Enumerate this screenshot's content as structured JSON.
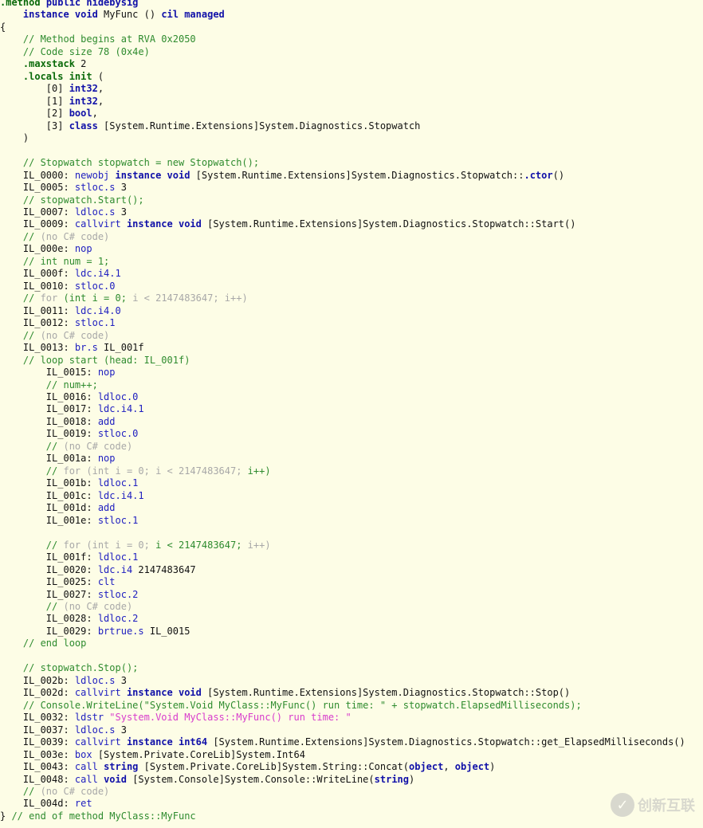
{
  "colors": {
    "keyword": "#1010a8",
    "opcode": "#2020c0",
    "comment": "#2e8b2e",
    "inactive": "#a8a8a8",
    "string": "#d83ccc",
    "background": "#fdfde6"
  },
  "watermark": {
    "text": "创新互联",
    "icon": "brand-logo-icon"
  },
  "lines": [
    [
      {
        "c": "d",
        "t": ".method"
      },
      {
        "c": "t",
        "t": " "
      },
      {
        "c": "k",
        "t": "public hidebysig"
      }
    ],
    [
      {
        "c": "t",
        "t": "    "
      },
      {
        "c": "k",
        "t": "instance void"
      },
      {
        "c": "t",
        "t": " MyFunc () "
      },
      {
        "c": "k",
        "t": "cil managed"
      }
    ],
    [
      {
        "c": "t",
        "t": "{"
      }
    ],
    [
      {
        "c": "c",
        "t": "    // Method begins at RVA 0x2050"
      }
    ],
    [
      {
        "c": "c",
        "t": "    // Code size 78 (0x4e)"
      }
    ],
    [
      {
        "c": "t",
        "t": "    "
      },
      {
        "c": "d",
        "t": ".maxstack"
      },
      {
        "c": "t",
        "t": " 2"
      }
    ],
    [
      {
        "c": "t",
        "t": "    "
      },
      {
        "c": "d",
        "t": ".locals init"
      },
      {
        "c": "t",
        "t": " ("
      }
    ],
    [
      {
        "c": "t",
        "t": "        [0] "
      },
      {
        "c": "k",
        "t": "int32"
      },
      {
        "c": "t",
        "t": ","
      }
    ],
    [
      {
        "c": "t",
        "t": "        [1] "
      },
      {
        "c": "k",
        "t": "int32"
      },
      {
        "c": "t",
        "t": ","
      }
    ],
    [
      {
        "c": "t",
        "t": "        [2] "
      },
      {
        "c": "k",
        "t": "bool"
      },
      {
        "c": "t",
        "t": ","
      }
    ],
    [
      {
        "c": "t",
        "t": "        [3] "
      },
      {
        "c": "k",
        "t": "class"
      },
      {
        "c": "t",
        "t": " [System.Runtime.Extensions]System.Diagnostics.Stopwatch"
      }
    ],
    [
      {
        "c": "t",
        "t": "    )"
      }
    ],
    [],
    [
      {
        "c": "c",
        "t": "    // Stopwatch stopwatch = new Stopwatch();"
      }
    ],
    [
      {
        "c": "t",
        "t": "    IL_0000: "
      },
      {
        "c": "o",
        "t": "newobj"
      },
      {
        "c": "t",
        "t": " "
      },
      {
        "c": "k",
        "t": "instance void"
      },
      {
        "c": "t",
        "t": " [System.Runtime.Extensions]System.Diagnostics.Stopwatch::"
      },
      {
        "c": "k",
        "t": ".ctor"
      },
      {
        "c": "t",
        "t": "()"
      }
    ],
    [
      {
        "c": "t",
        "t": "    IL_0005: "
      },
      {
        "c": "o",
        "t": "stloc.s"
      },
      {
        "c": "t",
        "t": " 3"
      }
    ],
    [
      {
        "c": "c",
        "t": "    // stopwatch.Start();"
      }
    ],
    [
      {
        "c": "t",
        "t": "    IL_0007: "
      },
      {
        "c": "o",
        "t": "ldloc.s"
      },
      {
        "c": "t",
        "t": " 3"
      }
    ],
    [
      {
        "c": "t",
        "t": "    IL_0009: "
      },
      {
        "c": "o",
        "t": "callvirt"
      },
      {
        "c": "t",
        "t": " "
      },
      {
        "c": "k",
        "t": "instance void"
      },
      {
        "c": "t",
        "t": " [System.Runtime.Extensions]System.Diagnostics.Stopwatch::Start()"
      }
    ],
    [
      {
        "c": "c",
        "t": "    //"
      },
      {
        "c": "g",
        "t": " (no C# code)"
      }
    ],
    [
      {
        "c": "t",
        "t": "    IL_000e: "
      },
      {
        "c": "o",
        "t": "nop"
      }
    ],
    [
      {
        "c": "c",
        "t": "    // int num = 1;"
      }
    ],
    [
      {
        "c": "t",
        "t": "    IL_000f: "
      },
      {
        "c": "o",
        "t": "ldc.i4.1"
      }
    ],
    [
      {
        "c": "t",
        "t": "    IL_0010: "
      },
      {
        "c": "o",
        "t": "stloc.0"
      }
    ],
    [
      {
        "c": "c",
        "t": "    //"
      },
      {
        "c": "g",
        "t": " for "
      },
      {
        "c": "c",
        "t": "(int i = 0;"
      },
      {
        "c": "g",
        "t": " i < 2147483647; i++)"
      }
    ],
    [
      {
        "c": "t",
        "t": "    IL_0011: "
      },
      {
        "c": "o",
        "t": "ldc.i4.0"
      }
    ],
    [
      {
        "c": "t",
        "t": "    IL_0012: "
      },
      {
        "c": "o",
        "t": "stloc.1"
      }
    ],
    [
      {
        "c": "c",
        "t": "    //"
      },
      {
        "c": "g",
        "t": " (no C# code)"
      }
    ],
    [
      {
        "c": "t",
        "t": "    IL_0013: "
      },
      {
        "c": "o",
        "t": "br.s"
      },
      {
        "c": "t",
        "t": " IL_001f"
      }
    ],
    [
      {
        "c": "c",
        "t": "    // loop start (head: IL_001f)"
      }
    ],
    [
      {
        "c": "t",
        "t": "        IL_0015: "
      },
      {
        "c": "o",
        "t": "nop"
      }
    ],
    [
      {
        "c": "c",
        "t": "        // num++;"
      }
    ],
    [
      {
        "c": "t",
        "t": "        IL_0016: "
      },
      {
        "c": "o",
        "t": "ldloc.0"
      }
    ],
    [
      {
        "c": "t",
        "t": "        IL_0017: "
      },
      {
        "c": "o",
        "t": "ldc.i4.1"
      }
    ],
    [
      {
        "c": "t",
        "t": "        IL_0018: "
      },
      {
        "c": "o",
        "t": "add"
      }
    ],
    [
      {
        "c": "t",
        "t": "        IL_0019: "
      },
      {
        "c": "o",
        "t": "stloc.0"
      }
    ],
    [
      {
        "c": "c",
        "t": "        //"
      },
      {
        "c": "g",
        "t": " (no C# code)"
      }
    ],
    [
      {
        "c": "t",
        "t": "        IL_001a: "
      },
      {
        "c": "o",
        "t": "nop"
      }
    ],
    [
      {
        "c": "c",
        "t": "        //"
      },
      {
        "c": "g",
        "t": " for (int i = 0; i < 2147483647; "
      },
      {
        "c": "c",
        "t": "i++)"
      }
    ],
    [
      {
        "c": "t",
        "t": "        IL_001b: "
      },
      {
        "c": "o",
        "t": "ldloc.1"
      }
    ],
    [
      {
        "c": "t",
        "t": "        IL_001c: "
      },
      {
        "c": "o",
        "t": "ldc.i4.1"
      }
    ],
    [
      {
        "c": "t",
        "t": "        IL_001d: "
      },
      {
        "c": "o",
        "t": "add"
      }
    ],
    [
      {
        "c": "t",
        "t": "        IL_001e: "
      },
      {
        "c": "o",
        "t": "stloc.1"
      }
    ],
    [],
    [
      {
        "c": "c",
        "t": "        //"
      },
      {
        "c": "g",
        "t": " for (int i = 0; "
      },
      {
        "c": "c",
        "t": "i < 2147483647;"
      },
      {
        "c": "g",
        "t": " i++)"
      }
    ],
    [
      {
        "c": "t",
        "t": "        IL_001f: "
      },
      {
        "c": "o",
        "t": "ldloc.1"
      }
    ],
    [
      {
        "c": "t",
        "t": "        IL_0020: "
      },
      {
        "c": "o",
        "t": "ldc.i4"
      },
      {
        "c": "t",
        "t": " 2147483647"
      }
    ],
    [
      {
        "c": "t",
        "t": "        IL_0025: "
      },
      {
        "c": "o",
        "t": "clt"
      }
    ],
    [
      {
        "c": "t",
        "t": "        IL_0027: "
      },
      {
        "c": "o",
        "t": "stloc.2"
      }
    ],
    [
      {
        "c": "c",
        "t": "        //"
      },
      {
        "c": "g",
        "t": " (no C# code)"
      }
    ],
    [
      {
        "c": "t",
        "t": "        IL_0028: "
      },
      {
        "c": "o",
        "t": "ldloc.2"
      }
    ],
    [
      {
        "c": "t",
        "t": "        IL_0029: "
      },
      {
        "c": "o",
        "t": "brtrue.s"
      },
      {
        "c": "t",
        "t": " IL_0015"
      }
    ],
    [
      {
        "c": "c",
        "t": "    // end loop"
      }
    ],
    [],
    [
      {
        "c": "c",
        "t": "    // stopwatch.Stop();"
      }
    ],
    [
      {
        "c": "t",
        "t": "    IL_002b: "
      },
      {
        "c": "o",
        "t": "ldloc.s"
      },
      {
        "c": "t",
        "t": " 3"
      }
    ],
    [
      {
        "c": "t",
        "t": "    IL_002d: "
      },
      {
        "c": "o",
        "t": "callvirt"
      },
      {
        "c": "t",
        "t": " "
      },
      {
        "c": "k",
        "t": "instance void"
      },
      {
        "c": "t",
        "t": " [System.Runtime.Extensions]System.Diagnostics.Stopwatch::Stop()"
      }
    ],
    [
      {
        "c": "c",
        "t": "    // Console.WriteLine(\"System.Void MyClass::MyFunc() run time: \" + stopwatch.ElapsedMilliseconds);"
      }
    ],
    [
      {
        "c": "t",
        "t": "    IL_0032: "
      },
      {
        "c": "o",
        "t": "ldstr"
      },
      {
        "c": "t",
        "t": " "
      },
      {
        "c": "s",
        "t": "\"System.Void MyClass::MyFunc() run time: \""
      }
    ],
    [
      {
        "c": "t",
        "t": "    IL_0037: "
      },
      {
        "c": "o",
        "t": "ldloc.s"
      },
      {
        "c": "t",
        "t": " 3"
      }
    ],
    [
      {
        "c": "t",
        "t": "    IL_0039: "
      },
      {
        "c": "o",
        "t": "callvirt"
      },
      {
        "c": "t",
        "t": " "
      },
      {
        "c": "k",
        "t": "instance int64"
      },
      {
        "c": "t",
        "t": " [System.Runtime.Extensions]System.Diagnostics.Stopwatch::get_ElapsedMilliseconds()"
      }
    ],
    [
      {
        "c": "t",
        "t": "    IL_003e: "
      },
      {
        "c": "o",
        "t": "box"
      },
      {
        "c": "t",
        "t": " [System.Private.CoreLib]System.Int64"
      }
    ],
    [
      {
        "c": "t",
        "t": "    IL_0043: "
      },
      {
        "c": "o",
        "t": "call"
      },
      {
        "c": "t",
        "t": " "
      },
      {
        "c": "k",
        "t": "string"
      },
      {
        "c": "t",
        "t": " [System.Private.CoreLib]System.String::Concat("
      },
      {
        "c": "k",
        "t": "object"
      },
      {
        "c": "t",
        "t": ", "
      },
      {
        "c": "k",
        "t": "object"
      },
      {
        "c": "t",
        "t": ")"
      }
    ],
    [
      {
        "c": "t",
        "t": "    IL_0048: "
      },
      {
        "c": "o",
        "t": "call"
      },
      {
        "c": "t",
        "t": " "
      },
      {
        "c": "k",
        "t": "void"
      },
      {
        "c": "t",
        "t": " [System.Console]System.Console::WriteLine("
      },
      {
        "c": "k",
        "t": "string"
      },
      {
        "c": "t",
        "t": ")"
      }
    ],
    [
      {
        "c": "c",
        "t": "    //"
      },
      {
        "c": "g",
        "t": " (no C# code)"
      }
    ],
    [
      {
        "c": "t",
        "t": "    IL_004d: "
      },
      {
        "c": "o",
        "t": "ret"
      }
    ],
    [
      {
        "c": "t",
        "t": "} "
      },
      {
        "c": "c",
        "t": "// end of method MyClass::MyFunc"
      }
    ]
  ]
}
